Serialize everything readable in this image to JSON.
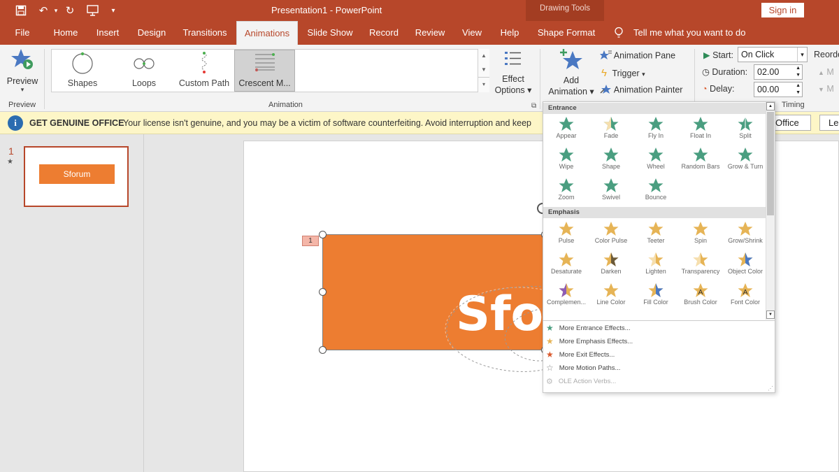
{
  "window": {
    "title": "Presentation1 - PowerPoint",
    "sign_in": "Sign in",
    "context_tab_group": "Drawing Tools"
  },
  "tabs": [
    "File",
    "Home",
    "Insert",
    "Design",
    "Transitions",
    "Animations",
    "Slide Show",
    "Record",
    "Review",
    "View",
    "Help",
    "Shape Format"
  ],
  "active_tab": "Animations",
  "tell_me": "Tell me what you want to do",
  "ribbon": {
    "preview": {
      "label": "Preview",
      "group": "Preview"
    },
    "animation_group": "Animation",
    "gallery": [
      "Shapes",
      "Loops",
      "Custom Path",
      "Crescent M..."
    ],
    "effect_options": [
      "Effect",
      "Options"
    ],
    "add_animation": [
      "Add",
      "Animation"
    ],
    "animation_pane": "Animation Pane",
    "trigger": "Trigger",
    "animation_painter": "Animation Painter",
    "timing": {
      "start_label": "Start:",
      "start_value": "On Click",
      "duration_label": "Duration:",
      "duration_value": "02.00",
      "delay_label": "Delay:",
      "delay_value": "00.00",
      "group": "Timing"
    },
    "reorder": "Reorde",
    "reorder_m": "M"
  },
  "message_bar": {
    "title": "GET GENUINE OFFICE",
    "text": "Your license isn't genuine, and you may be a victim of software counterfeiting. Avoid interruption and keep",
    "button1": "Office",
    "button2": "Lea"
  },
  "thumbnail": {
    "number": "1",
    "text": "Sforum"
  },
  "slide": {
    "anim_tag": "1",
    "text": "Sfor"
  },
  "dropdown": {
    "entrance_header": "Entrance",
    "entrance": [
      "Appear",
      "Fade",
      "Fly In",
      "Float In",
      "Split",
      "Wipe",
      "Shape",
      "Wheel",
      "Random Bars",
      "Grow & Turn",
      "Zoom",
      "Swivel",
      "Bounce"
    ],
    "emphasis_header": "Emphasis",
    "emphasis": [
      "Pulse",
      "Color Pulse",
      "Teeter",
      "Spin",
      "Grow/Shrink",
      "Desaturate",
      "Darken",
      "Lighten",
      "Transparency",
      "Object Color",
      "Complemen...",
      "Line Color",
      "Fill Color",
      "Brush Color",
      "Font Color"
    ],
    "more": [
      "More Entrance Effects...",
      "More Emphasis Effects...",
      "More Exit Effects...",
      "More Motion Paths...",
      "OLE Action Verbs..."
    ]
  },
  "colors": {
    "accent": "#b7472a",
    "shape": "#ed7d31",
    "entrance_star": "#4a9e80",
    "emphasis_star": "#e6b456"
  }
}
